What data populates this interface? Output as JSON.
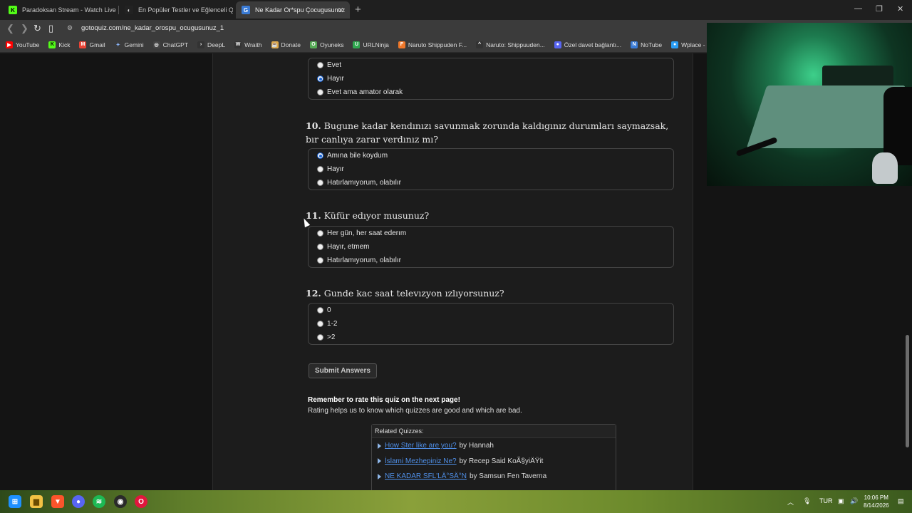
{
  "browser": {
    "tabs": [
      {
        "title": "Paradoksan Stream - Watch Live on K",
        "favicon": "K",
        "favicon_color": "#53fc18",
        "active": false
      },
      {
        "title": "En Popüler Testler ve Eğlenceli Quizle",
        "favicon": "◐",
        "favicon_color": "#222222",
        "active": false
      },
      {
        "title": "Ne Kadar Or*spu Çocugusunuz",
        "favicon": "G",
        "favicon_color": "#3a7bd5",
        "active": true
      }
    ],
    "new_tab": "+",
    "url": "gotoquiz.com/ne_kadar_orospu_ocugusunuz_1",
    "bookmarks": [
      {
        "label": "YouTube",
        "color": "#ff0000",
        "glyph": "▶"
      },
      {
        "label": "Kick",
        "color": "#53fc18",
        "glyph": "K"
      },
      {
        "label": "Gmail",
        "color": "#ea4335",
        "glyph": "M"
      },
      {
        "label": "Gemini",
        "color": "#8ab4f8",
        "glyph": "✦"
      },
      {
        "label": "ChatGPT",
        "color": "#444444",
        "glyph": "◎"
      },
      {
        "label": "DeepL",
        "color": "#333333",
        "glyph": ">"
      },
      {
        "label": "Wraith",
        "color": "#333333",
        "glyph": "W"
      },
      {
        "label": "Donate",
        "color": "#e0a84a",
        "glyph": "☕"
      },
      {
        "label": "Oyuneks",
        "color": "#55aa55",
        "glyph": "O"
      },
      {
        "label": "URLNinja",
        "color": "#2fa84f",
        "glyph": "U"
      },
      {
        "label": "Naruto Shippuden F...",
        "color": "#f0782a",
        "glyph": "F"
      },
      {
        "label": "Naruto: Shippuuden...",
        "color": "#333333",
        "glyph": "^"
      },
      {
        "label": "Özel davet bağlantı...",
        "color": "#5865f2",
        "glyph": "●"
      },
      {
        "label": "NoTube",
        "color": "#3a7bd5",
        "glyph": "N"
      },
      {
        "label": "Wplace - Paint the...",
        "color": "#2a9df4",
        "glyph": "●"
      }
    ]
  },
  "quiz": {
    "q9": {
      "options": [
        {
          "label": "Evet",
          "checked": false
        },
        {
          "label": "Hayır",
          "checked": true
        },
        {
          "label": "Evet ama amator olarak",
          "checked": false
        }
      ]
    },
    "q10": {
      "number": "10.",
      "text": "Bugune kadar kendınızı savunmak zorunda kaldıgınız durumları saymazsak, bır canlıya zarar verdınız mı?",
      "options": [
        {
          "label": "Amına bile koydum",
          "checked": true
        },
        {
          "label": "Hayır",
          "checked": false
        },
        {
          "label": "Hatırlamıyorum, olabılır",
          "checked": false
        }
      ]
    },
    "q11": {
      "number": "11.",
      "text": "Küfür edıyor musunuz?",
      "options": [
        {
          "label": "Her gün, her saat ederım",
          "checked": false
        },
        {
          "label": "Hayır, etmem",
          "checked": false
        },
        {
          "label": "Hatırlamıyorum, olabılır",
          "checked": false
        }
      ]
    },
    "q12": {
      "number": "12.",
      "text": "Gunde kac saat televızyon ızlıyorsunuz?",
      "options": [
        {
          "label": "0",
          "checked": false
        },
        {
          "label": "1-2",
          "checked": false
        },
        {
          "label": ">2",
          "checked": false
        }
      ]
    },
    "submit_label": "Submit Answers",
    "rate_title": "Remember to rate this quiz on the next page!",
    "rate_text": "Rating helps us to know which quizzes are good and which are bad."
  },
  "related": {
    "heading": "Related Quizzes:",
    "items": [
      {
        "title": "How Ster like are you?",
        "author": "by Hannah"
      },
      {
        "title": "İslami Mezhepiniz Ne?",
        "author": "by Recep Said KoÃ§yiÄŸit"
      },
      {
        "title": "NE KADAR SFL'LÄ°SÄ°N",
        "author": "by Samsun Fen Taverna"
      }
    ]
  },
  "system": {
    "language": "TUR",
    "time": "10:06 PM",
    "date": "8/14/2026"
  }
}
